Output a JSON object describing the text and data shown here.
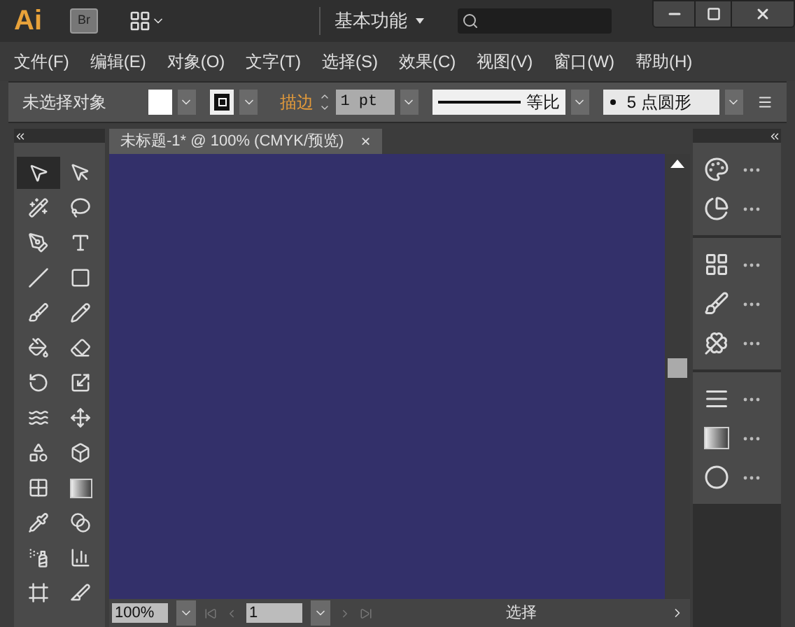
{
  "app_bar": {
    "logo": "Ai",
    "bridge": "Br",
    "workspace": "基本功能"
  },
  "menus": [
    "文件(F)",
    "编辑(E)",
    "对象(O)",
    "文字(T)",
    "选择(S)",
    "效果(C)",
    "视图(V)",
    "窗口(W)",
    "帮助(H)"
  ],
  "control_bar": {
    "selection": "未选择对象",
    "stroke_label": "描边",
    "stroke_weight": "1 pt",
    "stroke_profile": "等比",
    "brush": "5 点圆形"
  },
  "document_tab": {
    "title": "未标题-1* @ 100% (CMYK/预览)",
    "close": "×"
  },
  "tools": [
    {
      "kind": "selection",
      "selected": true
    },
    {
      "kind": "direct-selection",
      "selected": false
    },
    {
      "kind": "magic-wand",
      "selected": false
    },
    {
      "kind": "lasso",
      "selected": false
    },
    {
      "kind": "pen",
      "selected": false
    },
    {
      "kind": "type",
      "selected": false
    },
    {
      "kind": "line",
      "selected": false
    },
    {
      "kind": "rectangle",
      "selected": false
    },
    {
      "kind": "paintbrush",
      "selected": false
    },
    {
      "kind": "pencil",
      "selected": false
    },
    {
      "kind": "blob-brush",
      "selected": false
    },
    {
      "kind": "eraser",
      "selected": false
    },
    {
      "kind": "rotate",
      "selected": false
    },
    {
      "kind": "scale",
      "selected": false
    },
    {
      "kind": "warp",
      "selected": false
    },
    {
      "kind": "free-transform",
      "selected": false
    },
    {
      "kind": "shape-builder",
      "selected": false
    },
    {
      "kind": "perspective",
      "selected": false
    },
    {
      "kind": "mesh",
      "selected": false
    },
    {
      "kind": "gradient",
      "selected": false
    },
    {
      "kind": "eyedropper",
      "selected": false
    },
    {
      "kind": "blend",
      "selected": false
    },
    {
      "kind": "symbol-sprayer",
      "selected": false
    },
    {
      "kind": "column-graph",
      "selected": false
    },
    {
      "kind": "artboard",
      "selected": false
    },
    {
      "kind": "slice",
      "selected": false
    }
  ],
  "panel_groups": [
    [
      {
        "kind": "color"
      },
      {
        "kind": "color-guide"
      }
    ],
    [
      {
        "kind": "swatches"
      },
      {
        "kind": "brushes"
      },
      {
        "kind": "symbols"
      }
    ],
    [
      {
        "kind": "stroke"
      },
      {
        "kind": "gradient"
      },
      {
        "kind": "transparency"
      }
    ]
  ],
  "status_bar": {
    "zoom": "100%",
    "page": "1",
    "status": "选择"
  }
}
